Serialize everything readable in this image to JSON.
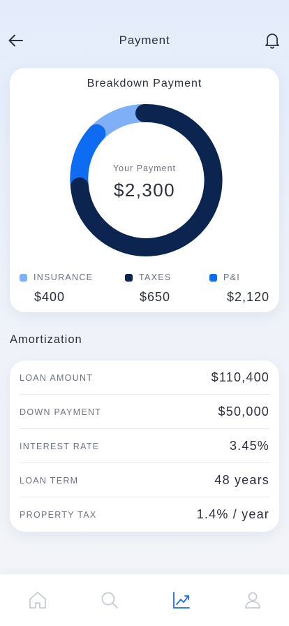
{
  "header": {
    "title": "Payment",
    "back_icon": "arrow-left-icon",
    "notification_icon": "bell-icon"
  },
  "breakdown": {
    "title": "Breakdown Payment",
    "total_label": "Your Payment",
    "total_value": "$2,300",
    "legend": [
      {
        "name": "INSURANCE",
        "value": "$400",
        "color": "#7fb0f7"
      },
      {
        "name": "TAXES",
        "value": "$650",
        "color": "#0b2550"
      },
      {
        "name": "P&I",
        "value": "$2,120",
        "color": "#0d6cf2"
      }
    ]
  },
  "amortization": {
    "title": "Amortization",
    "rows": [
      {
        "label": "LOAN AMOUNT",
        "value": "$110,400"
      },
      {
        "label": "DOWN PAYMENT",
        "value": "$50,000"
      },
      {
        "label": "INTEREST RATE",
        "value": "3.45%"
      },
      {
        "label": "LOAN TERM",
        "value": "48 years"
      },
      {
        "label": "PROPERTY TAX",
        "value": "1.4% / year"
      }
    ]
  },
  "tabs": [
    {
      "icon": "home-icon",
      "active": false
    },
    {
      "icon": "search-icon",
      "active": false
    },
    {
      "icon": "chart-icon",
      "active": true
    },
    {
      "icon": "user-icon",
      "active": false
    }
  ],
  "colors": {
    "accent": "#1a6be8",
    "inactive_icon": "#c4cad6",
    "donut_dark": "#0b2550",
    "donut_blue": "#0d6cf2",
    "donut_light": "#7fb0f7"
  }
}
